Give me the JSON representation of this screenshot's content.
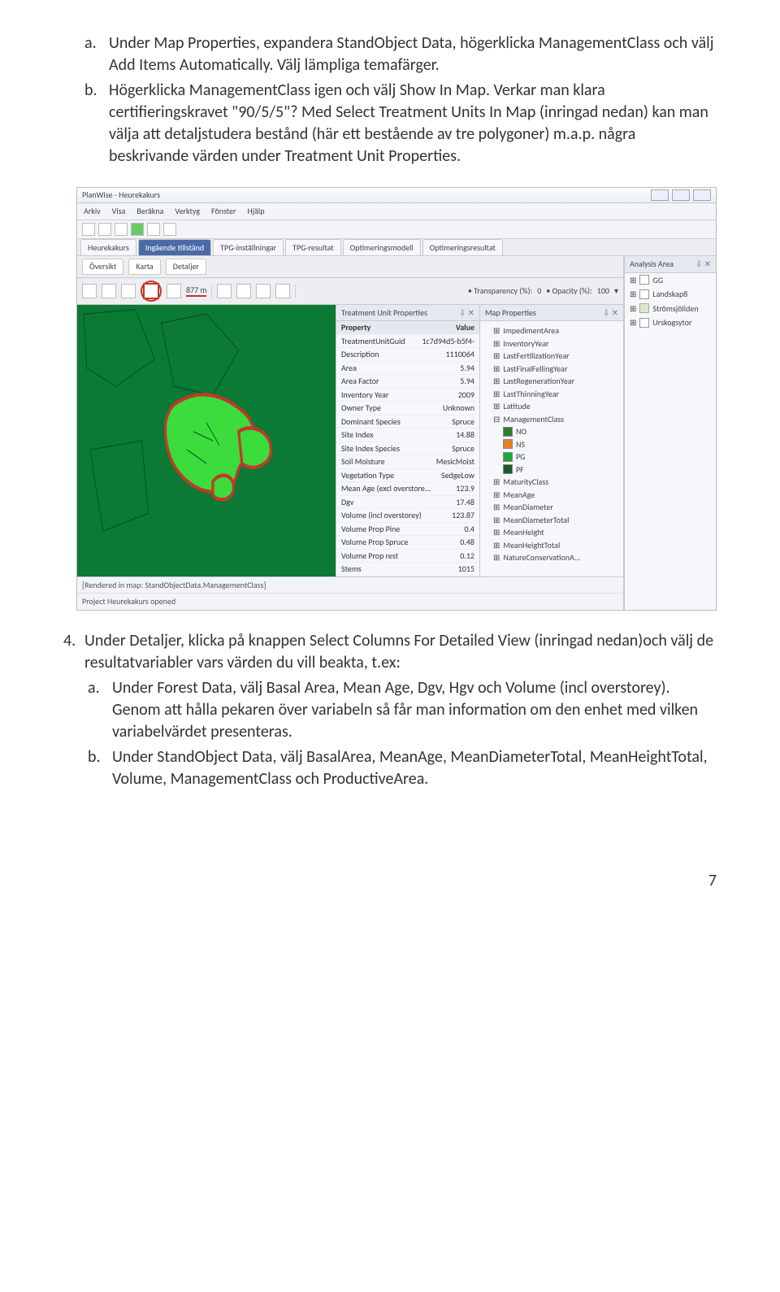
{
  "doc": {
    "list_top": {
      "a": {
        "marker": "a.",
        "text": "Under Map Properties, expandera StandObject Data, högerklicka ManagementClass och välj Add Items Automatically. Välj lämpliga temafärger."
      },
      "b": {
        "marker": "b.",
        "text": "Högerklicka ManagementClass igen och välj Show In Map. Verkar man klara certifieringskravet \"90/5/5\"? Med Select Treatment Units In Map (inringad nedan) kan man välja att detaljstudera bestånd (här ett bestående av tre polygoner) m.a.p. några beskrivande värden under Treatment Unit Properties."
      }
    },
    "list_bottom": {
      "n4": {
        "marker": "4.",
        "text": "Under Detaljer, klicka på knappen Select Columns For Detailed View (inringad nedan)och välj de resultatvariabler vars värden du vill beakta, t.ex:"
      },
      "a": {
        "marker": "a.",
        "text": "Under Forest Data, välj Basal Area, Mean Age, Dgv, Hgv och Volume (incl overstorey). Genom att hålla pekaren över variabeln så får man information om den enhet med vilken variabelvärdet presenteras."
      },
      "b": {
        "marker": "b.",
        "text": "Under StandObject Data, välj BasalArea, MeanAge, MeanDiameterTotal, MeanHeightTotal, Volume, ManagementClass och ProductiveArea."
      }
    },
    "page_number": "7"
  },
  "ss": {
    "title": "PlanWise - Heurekakurs",
    "menu": [
      "Arkiv",
      "Visa",
      "Beräkna",
      "Verktyg",
      "Fönster",
      "Hjälp"
    ],
    "main_tabs": [
      "Heurekakurs",
      "Ingående tillstånd",
      "TPG-inställningar",
      "TPG-resultat",
      "Optimeringsmodell",
      "Optimeringsresultat"
    ],
    "sub_tabs": [
      "Översikt",
      "Karta",
      "Detaljer"
    ],
    "maptools": {
      "scale": "877 m",
      "transparency_label": "Transparency (%):",
      "transparency_val": "0",
      "opacity_label": "Opacity (%):",
      "opacity_val": "100"
    },
    "tup": {
      "title": "Treatment Unit Properties",
      "header_prop": "Property",
      "header_val": "Value",
      "rows": [
        {
          "k": "TreatmentUnitGuid",
          "v": "1c7d94d5-b5f4-"
        },
        {
          "k": "Description",
          "v": "1110064"
        },
        {
          "k": "Area",
          "v": "5.94"
        },
        {
          "k": "Area Factor",
          "v": "5.94"
        },
        {
          "k": "Inventory Year",
          "v": "2009"
        },
        {
          "k": "Owner Type",
          "v": "Unknown"
        },
        {
          "k": "Dominant Species",
          "v": "Spruce"
        },
        {
          "k": "Site Index",
          "v": "14.88"
        },
        {
          "k": "Site Index Species",
          "v": "Spruce"
        },
        {
          "k": "Soil Moisture",
          "v": "MesicMoist"
        },
        {
          "k": "Vegetation Type",
          "v": "SedgeLow"
        },
        {
          "k": "Mean Age (excl overstore...",
          "v": "123.9"
        },
        {
          "k": "Dgv",
          "v": "17.48"
        },
        {
          "k": "Volume (incl overstorey)",
          "v": "123.87"
        },
        {
          "k": "Volume Prop Pine",
          "v": "0.4"
        },
        {
          "k": "Volume Prop Spruce",
          "v": "0.48"
        },
        {
          "k": "Volume Prop rest",
          "v": "0.12"
        },
        {
          "k": "Stems",
          "v": "1015"
        }
      ]
    },
    "mp": {
      "title": "Map Properties",
      "items": [
        {
          "lvl": 1,
          "txt": "ImpedimentArea"
        },
        {
          "lvl": 1,
          "txt": "InventoryYear"
        },
        {
          "lvl": 1,
          "txt": "LastFertilizationYear"
        },
        {
          "lvl": 1,
          "txt": "LastFinalFellingYear"
        },
        {
          "lvl": 1,
          "txt": "LastRegenerationYear"
        },
        {
          "lvl": 1,
          "txt": "LastThinningYear"
        },
        {
          "lvl": 1,
          "txt": "Latitude"
        },
        {
          "lvl": 1,
          "txt": "ManagementClass",
          "exp": true
        },
        {
          "lvl": 2,
          "txt": "NO",
          "sw": "#2e7d32"
        },
        {
          "lvl": 2,
          "txt": "NS",
          "sw": "#e67e22"
        },
        {
          "lvl": 2,
          "txt": "PG",
          "sw": "#1aa839"
        },
        {
          "lvl": 2,
          "txt": "PF",
          "sw": "#155d27"
        },
        {
          "lvl": 1,
          "txt": "MaturityClass"
        },
        {
          "lvl": 1,
          "txt": "MeanAge"
        },
        {
          "lvl": 1,
          "txt": "MeanDiameter"
        },
        {
          "lvl": 1,
          "txt": "MeanDiameterTotal"
        },
        {
          "lvl": 1,
          "txt": "MeanHeight"
        },
        {
          "lvl": 1,
          "txt": "MeanHeightTotal"
        },
        {
          "lvl": 1,
          "txt": "NatureConservationA..."
        }
      ]
    },
    "analysis": {
      "title": "Analysis Area",
      "items": [
        {
          "txt": "GG",
          "chk": false
        },
        {
          "txt": "Landskap8",
          "chk": false
        },
        {
          "txt": "Strömsjöliden",
          "chk": true
        },
        {
          "txt": "Urskogsytor",
          "chk": false
        }
      ]
    },
    "status1": "[Rendered in map: StandObjectData.ManagementClass]",
    "status2": "Project Heurekakurs opened",
    "panel_pinx": "⇩ ✕"
  }
}
